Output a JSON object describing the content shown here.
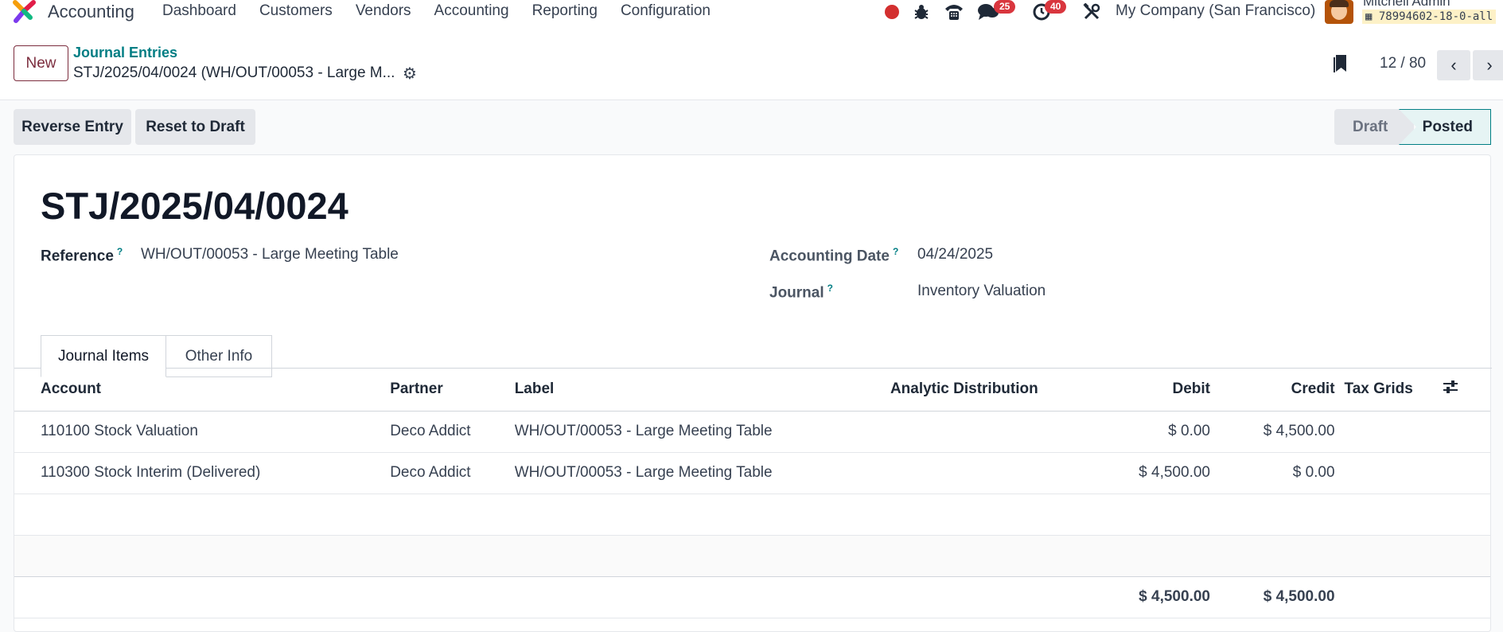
{
  "navbar": {
    "app_name": "Accounting",
    "menu": [
      "Dashboard",
      "Customers",
      "Vendors",
      "Accounting",
      "Reporting",
      "Configuration"
    ],
    "messages_count": "25",
    "activities_count": "40",
    "company": "My Company (San Francisco)",
    "user_name": "Mitchell Admin",
    "database": "78994602-18-0-all"
  },
  "control": {
    "new_label": "New",
    "breadcrumb_parent": "Journal Entries",
    "breadcrumb_current": "STJ/2025/04/0024 (WH/OUT/00053 - Large M...",
    "pager": "12 / 80"
  },
  "actions": {
    "reverse": "Reverse Entry",
    "reset": "Reset to Draft"
  },
  "statusbar": {
    "draft": "Draft",
    "posted": "Posted"
  },
  "form": {
    "name": "STJ/2025/04/0024",
    "reference_label": "Reference",
    "reference_value": "WH/OUT/00053 - Large Meeting Table",
    "date_label": "Accounting Date",
    "date_value": "04/24/2025",
    "journal_label": "Journal",
    "journal_value": "Inventory Valuation",
    "help_mark": "?"
  },
  "tabs": [
    "Journal Items",
    "Other Info"
  ],
  "lines": {
    "headers": {
      "account": "Account",
      "partner": "Partner",
      "label": "Label",
      "analytic": "Analytic Distribution",
      "debit": "Debit",
      "credit": "Credit",
      "tax_grids": "Tax Grids"
    },
    "rows": [
      {
        "account": "110100 Stock Valuation",
        "partner": "Deco Addict",
        "label": "WH/OUT/00053 - Large Meeting Table",
        "analytic": "",
        "debit": "$ 0.00",
        "credit": "$ 4,500.00",
        "tax_grids": ""
      },
      {
        "account": "110300 Stock Interim (Delivered)",
        "partner": "Deco Addict",
        "label": "WH/OUT/00053 - Large Meeting Table",
        "analytic": "",
        "debit": "$ 4,500.00",
        "credit": "$ 0.00",
        "tax_grids": ""
      }
    ],
    "totals": {
      "debit": "$ 4,500.00",
      "credit": "$ 4,500.00"
    }
  }
}
